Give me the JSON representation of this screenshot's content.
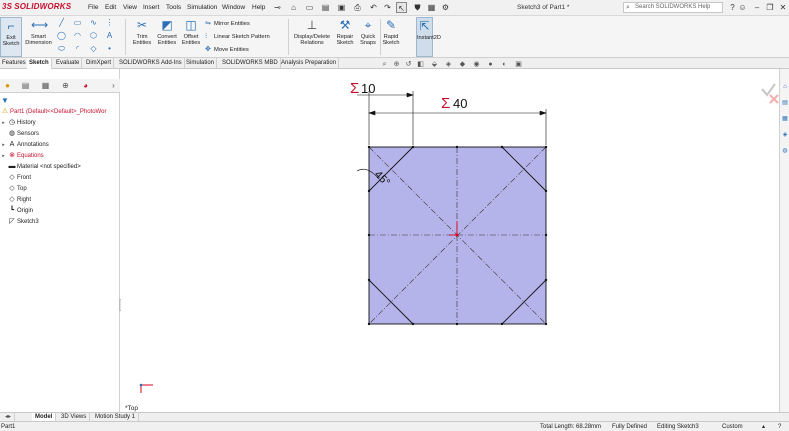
{
  "app": {
    "logo_text": "SOLIDWORKS",
    "document_title": "Sketch3 of Part1 *",
    "accent_color": "#c8102e",
    "sketch_fill_color": "#b4b4ea"
  },
  "menu": [
    "File",
    "Edit",
    "View",
    "Insert",
    "Tools",
    "Simulation",
    "Window",
    "Help"
  ],
  "help_search": {
    "placeholder": "Search SOLIDWORKS Help"
  },
  "command_manager": {
    "exit_sketch": "Exit Sketch",
    "smart_dimension": "Smart Dimension",
    "trim_entities": "Trim Entities",
    "convert_entities": "Convert Entities",
    "offset_entities": "Offset Entities",
    "mirror_entities": "Mirror Entities",
    "linear_sketch_pattern": "Linear Sketch Pattern",
    "move_entities": "Move Entities",
    "display_delete_relations": "Display/Delete Relations",
    "repair_sketch": "Repair Sketch",
    "quick_snaps": "Quick Snaps",
    "rapid_sketch": "Rapid Sketch",
    "instant2d": "Instant2D"
  },
  "tabs": [
    "Features",
    "Sketch",
    "Evaluate",
    "DimXpert",
    "SOLIDWORKS Add-Ins",
    "Simulation",
    "SOLIDWORKS MBD",
    "Analysis Preparation"
  ],
  "active_tab": "Sketch",
  "feature_tree": {
    "part": "Part1  (Default<<Default>_PhotoWor",
    "items": [
      "History",
      "Sensors",
      "Annotations",
      "Equations",
      "Material <not specified>",
      "Front",
      "Top",
      "Right",
      "Origin",
      "Sketch3"
    ]
  },
  "sketch": {
    "dim_small": "10",
    "dim_large": "40",
    "equation_symbol": "Σ",
    "angle": "45°"
  },
  "view": {
    "orientation": "*Top"
  },
  "bottom_tabs": [
    "Model",
    "3D Views",
    "Motion Study 1"
  ],
  "active_bottom_tab": "Model",
  "status": {
    "doc": "Part1",
    "total_length": "Total Length: 68.28mm",
    "definition": "Fully Defined",
    "mode": "Editing Sketch3",
    "units": "Custom"
  }
}
